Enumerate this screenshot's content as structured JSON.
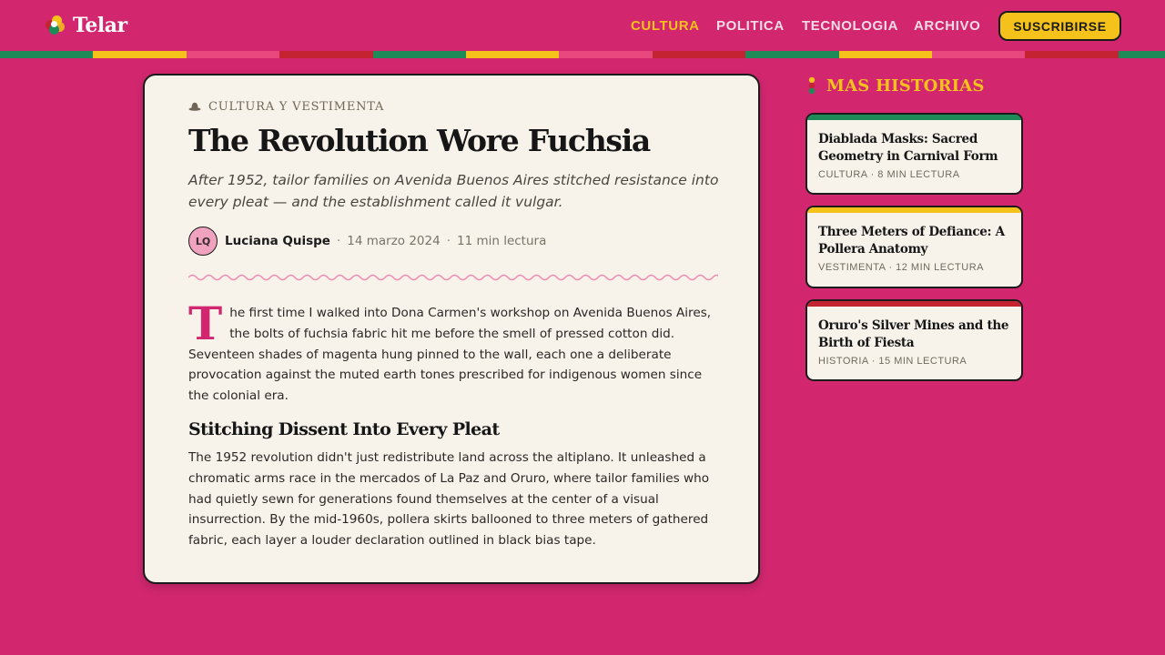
{
  "header": {
    "brand": "Telar",
    "nav": [
      {
        "label": "CULTURA",
        "active": true
      },
      {
        "label": "POLITICA",
        "active": false
      },
      {
        "label": "TECNOLOGIA",
        "active": false
      },
      {
        "label": "ARCHIVO",
        "active": false
      }
    ],
    "subscribe_label": "SUSCRIBIRSE"
  },
  "colors": {
    "background": "#d2276f",
    "accent_yellow": "#f5c21b",
    "green": "#1e8a57",
    "pink": "#e8487e",
    "red": "#c42431",
    "card_bg": "#f7f3ea"
  },
  "article": {
    "kicker_icon": "hat-icon",
    "kicker": "CULTURA Y VESTIMENTA",
    "headline": "The Revolution Wore Fuchsia",
    "deck": "After 1952, tailor families on Avenida Buenos Aires stitched resistance into every pleat — and the establishment called it vulgar.",
    "author_initials": "LQ",
    "author": "Luciana Quispe",
    "date": "14 marzo 2024",
    "read_time": "11 min lectura",
    "separator": "·",
    "dropcap": "T",
    "para1": "he first time I walked into Dona Carmen's workshop on Avenida Buenos Aires, the bolts of fuchsia fabric hit me before the smell of pressed cotton did. Seventeen shades of magenta hung pinned to the wall, each one a deliberate provocation against the muted earth tones prescribed for indigenous women since the colonial era.",
    "subhead": "Stitching Dissent Into Every Pleat",
    "para2": "The 1952 revolution didn't just redistribute land across the altiplano. It unleashed a chromatic arms race in the mercados of La Paz and Oruro, where tailor families who had quietly sewn for generations found themselves at the center of a visual insurrection. By the mid-1960s, pollera skirts ballooned to three meters of gathered fabric, each layer a louder declaration outlined in black bias tape."
  },
  "sidebar": {
    "title_icon": "traffic-dots-icon",
    "title": "MAS HISTORIAS",
    "stories": [
      {
        "title": "Diablada Masks: Sacred Geometry in Carnival Form",
        "meta": "CULTURA · 8 MIN LECTURA",
        "bar_color": "#1e8a57"
      },
      {
        "title": "Three Meters of Defiance: A Pollera Anatomy",
        "meta": "VESTIMENTA · 12 MIN LECTURA",
        "bar_color": "#f5c21b"
      },
      {
        "title": "Oruro's Silver Mines and the Birth of Fiesta",
        "meta": "HISTORIA · 15 MIN LECTURA",
        "bar_color": "#c42431"
      }
    ]
  }
}
